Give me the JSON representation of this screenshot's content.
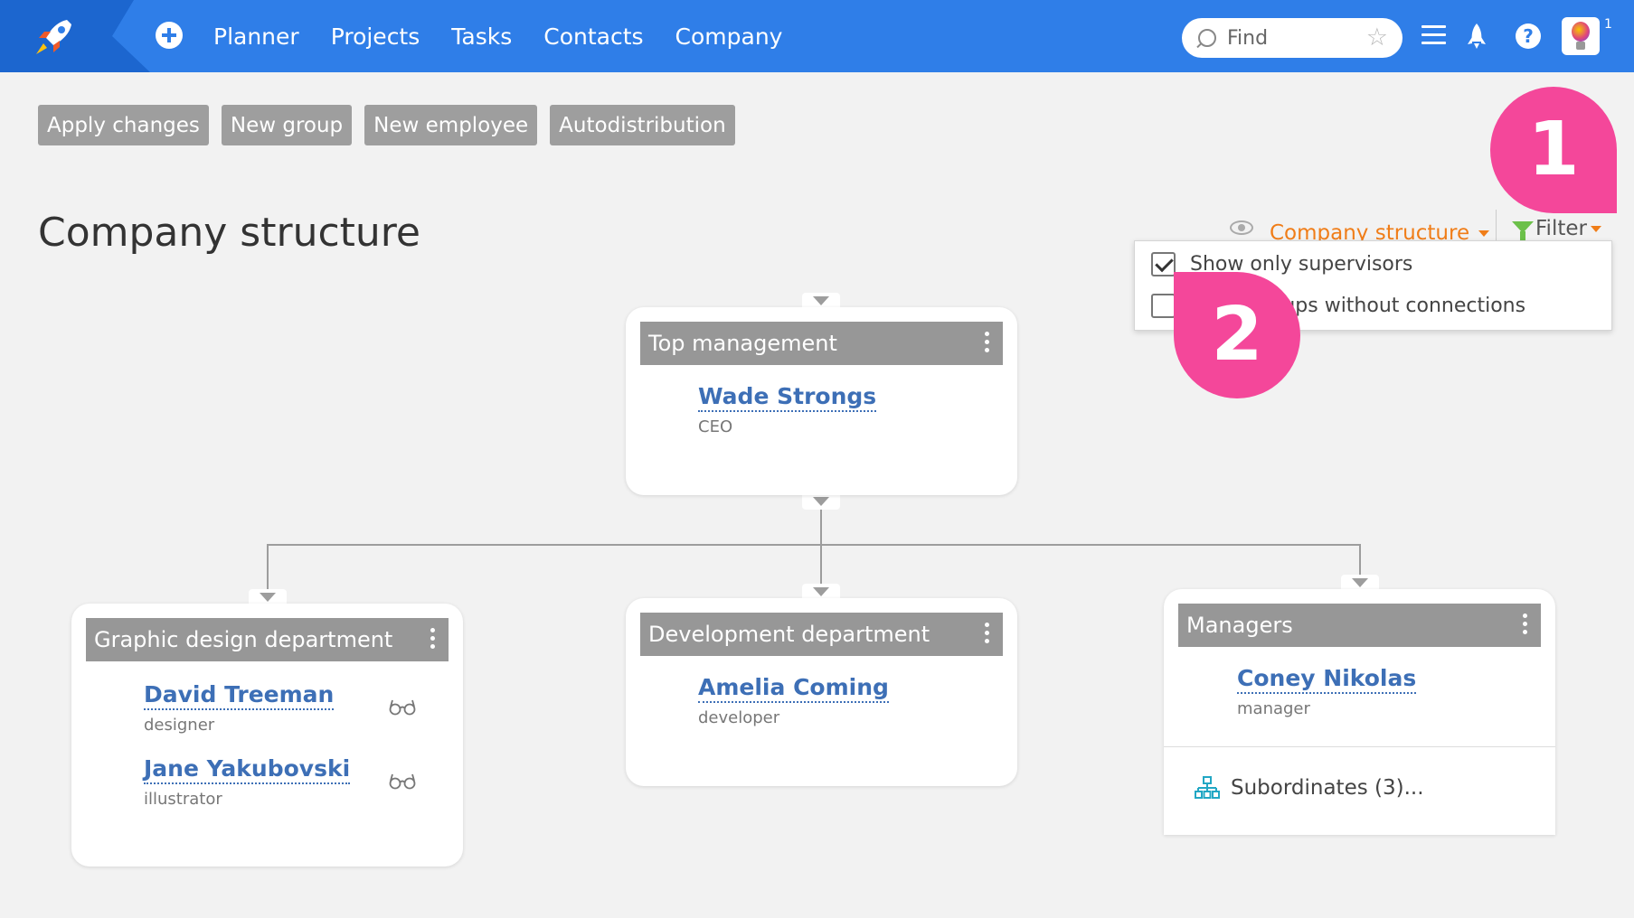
{
  "nav": {
    "items": [
      "Planner",
      "Projects",
      "Tasks",
      "Contacts",
      "Company"
    ]
  },
  "search": {
    "placeholder": "Find"
  },
  "notifications": {
    "count": "1"
  },
  "toolbar": {
    "apply_changes": "Apply changes",
    "new_group": "New group",
    "new_employee": "New employee",
    "autodistribution": "Autodistribution"
  },
  "page": {
    "title": "Company structure"
  },
  "view": {
    "label": "Company structure"
  },
  "filter": {
    "label": "Filter",
    "options": [
      {
        "label": "Show only supervisors",
        "checked": true
      },
      {
        "label": "Show groups without connections",
        "checked": false
      }
    ]
  },
  "badges": {
    "one": "1",
    "two": "2"
  },
  "colors": {
    "topbar": "#2f7ee8",
    "accent_orange": "#f07d18",
    "link_blue": "#3d6fb6",
    "badge_pink": "#f4479a",
    "filter_green": "#6cc04a"
  },
  "groups": {
    "top": {
      "title": "Top management",
      "people": [
        {
          "name": "Wade Strongs",
          "role": "CEO"
        }
      ]
    },
    "design": {
      "title": "Graphic design department",
      "people": [
        {
          "name": "David Treeman",
          "role": "designer"
        },
        {
          "name": "Jane Yakubovski",
          "role": "illustrator"
        }
      ]
    },
    "dev": {
      "title": "Development department",
      "people": [
        {
          "name": "Amelia Coming",
          "role": "developer"
        }
      ]
    },
    "managers": {
      "title": "Managers",
      "people": [
        {
          "name": "Coney Nikolas",
          "role": "manager"
        }
      ],
      "subordinates": "Subordinates (3)..."
    }
  }
}
